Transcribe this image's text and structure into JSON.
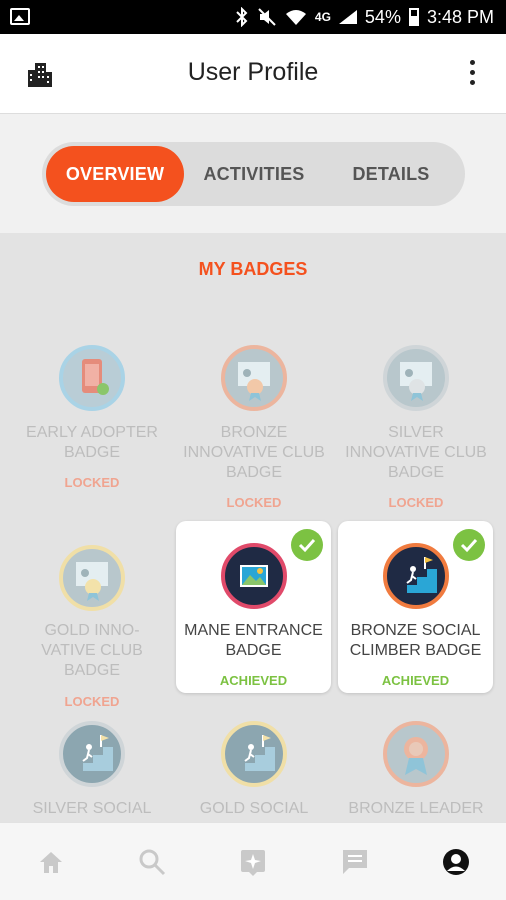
{
  "status_bar": {
    "battery": "54%",
    "time": "3:48 PM",
    "network": "4G"
  },
  "app_bar": {
    "title": "User Profile"
  },
  "tabs": [
    {
      "label": "OVERVIEW",
      "active": true
    },
    {
      "label": "ACTIVITIES",
      "active": false
    },
    {
      "label": "DETAILS",
      "active": false
    }
  ],
  "section_title": "MY BADGES",
  "badges": [
    {
      "name": "EARLY ADOPTER BADGE",
      "status": "LOCKED"
    },
    {
      "name": "BRONZE INNOVATIVE CLUB BADGE",
      "status": "LOCKED"
    },
    {
      "name": "SILVER INNOVATIVE CLUB BADGE",
      "status": "LOCKED"
    },
    {
      "name": "GOLD INNO-VATIVE CLUB BADGE",
      "status": "LOCKED"
    },
    {
      "name": "MANE ENTRANCE BADGE",
      "status": "ACHIEVED"
    },
    {
      "name": "BRONZE SOCIAL CLIMBER BADGE",
      "status": "ACHIEVED"
    },
    {
      "name": "SILVER SOCIAL",
      "status": ""
    },
    {
      "name": "GOLD SOCIAL",
      "status": ""
    },
    {
      "name": "BRONZE LEADER",
      "status": ""
    }
  ],
  "badge_icons": {
    "phone-badge-icon": "phone",
    "certificate-badge-icon": "certificate",
    "photo-badge-icon": "photo",
    "climber-badge-icon": "stairs-flag"
  },
  "bottom_nav": [
    {
      "icon": "home-icon"
    },
    {
      "icon": "search-icon"
    },
    {
      "icon": "sparkle-icon"
    },
    {
      "icon": "chat-icon"
    },
    {
      "icon": "profile-icon",
      "active": true
    }
  ],
  "colors": {
    "accent": "#f4511e",
    "achieved": "#7cc242",
    "locked": "#f0a490"
  }
}
